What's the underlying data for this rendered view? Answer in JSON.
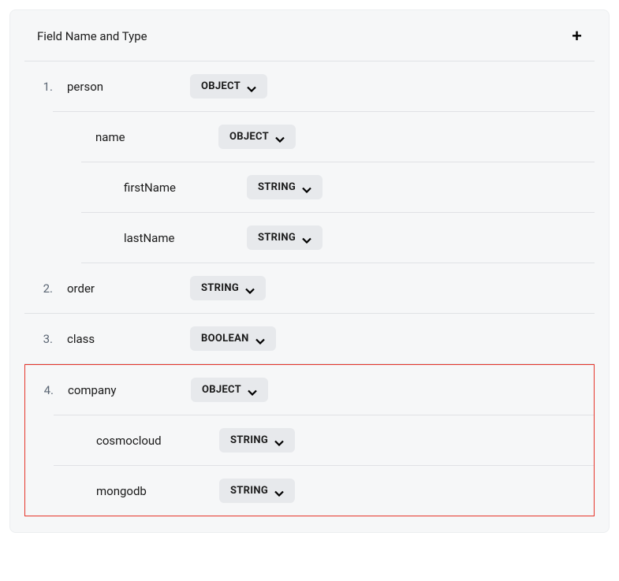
{
  "header": {
    "title": "Field Name and Type"
  },
  "fields": [
    {
      "num": "1.",
      "name": "person",
      "type": "OBJECT",
      "children": [
        {
          "name": "name",
          "type": "OBJECT",
          "children": [
            {
              "name": "firstName",
              "type": "STRING"
            },
            {
              "name": "lastName",
              "type": "STRING"
            }
          ]
        }
      ]
    },
    {
      "num": "2.",
      "name": "order",
      "type": "STRING"
    },
    {
      "num": "3.",
      "name": "class",
      "type": "BOOLEAN"
    },
    {
      "num": "4.",
      "name": "company",
      "type": "OBJECT",
      "highlighted": true,
      "children": [
        {
          "name": "cosmocloud",
          "type": "STRING"
        },
        {
          "name": "mongodb",
          "type": "STRING"
        }
      ]
    }
  ]
}
